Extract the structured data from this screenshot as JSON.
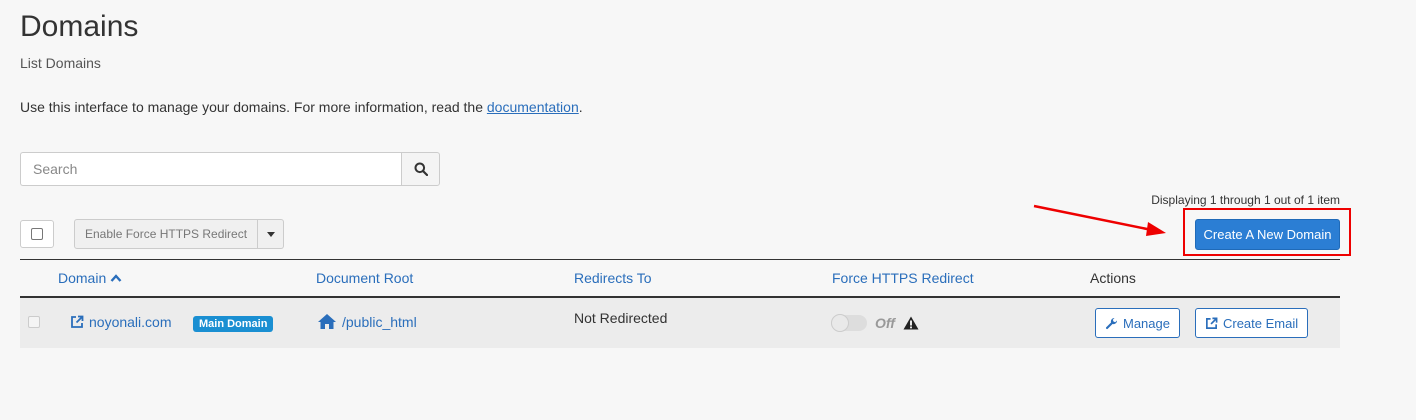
{
  "page": {
    "title": "Domains",
    "subtitle": "List Domains",
    "intro_text": "Use this interface to manage your domains. For more information, read the",
    "intro_link": "documentation",
    "intro_end": "."
  },
  "search": {
    "placeholder": "Search",
    "icon": "search-icon"
  },
  "paging": {
    "text": "Displaying 1 through 1 out of 1 item"
  },
  "toolbar": {
    "force_https_label": "Enable Force HTTPS Redirect",
    "create_label": "Create A New Domain"
  },
  "table": {
    "headers": {
      "domain": "Domain",
      "document_root": "Document Root",
      "redirects_to": "Redirects To",
      "force_https": "Force HTTPS Redirect",
      "actions": "Actions"
    },
    "rows": [
      {
        "domain": "noyonali.com",
        "badge": "Main Domain",
        "document_root": "/public_html",
        "redirects_to": "Not Redirected",
        "force_https": "Off",
        "manage_label": "Manage",
        "email_label": "Create Email"
      }
    ]
  },
  "colors": {
    "accent": "#2b7ed4",
    "link": "#2a6ebb",
    "badge": "#1a8fd2",
    "highlight": "#e00000"
  }
}
